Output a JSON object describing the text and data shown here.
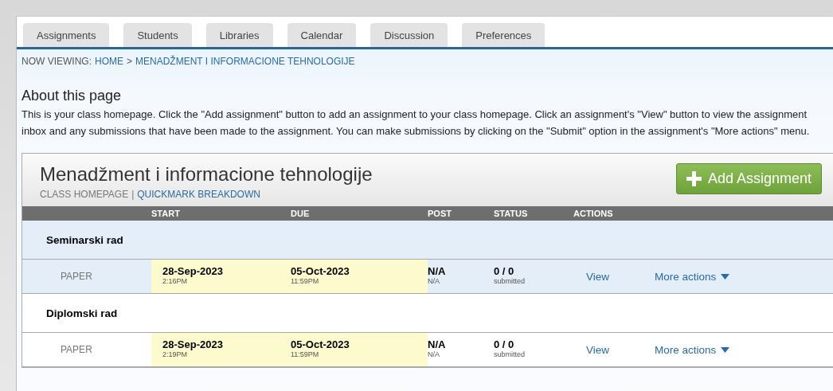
{
  "tabs": [
    {
      "label": "Assignments",
      "selected": false
    },
    {
      "label": "Students",
      "selected": false
    },
    {
      "label": "Libraries",
      "selected": false
    },
    {
      "label": "Calendar",
      "selected": false
    },
    {
      "label": "Discussion",
      "selected": false
    },
    {
      "label": "Preferences",
      "selected": false
    }
  ],
  "breadcrumb": {
    "prefix": "NOW VIEWING:",
    "links": [
      "HOME",
      "MENADŽMENT I INFORMACIONE TEHNOLOGIJE"
    ],
    "separator": ">"
  },
  "about": {
    "title": "About this page",
    "text": "This is your class homepage. Click the \"Add assignment\" button to add an assignment to your class homepage. Click an assignment's \"View\" button to view the assignment inbox and any submissions that have been made to the assignment. You can make submissions by clicking on the \"Submit\" option in the assignment's \"More actions\" menu."
  },
  "class": {
    "title": "Menadžment i informacione tehnologije",
    "subnav": [
      "CLASS HOMEPAGE",
      "QUICKMARK BREAKDOWN"
    ],
    "subnav_separator": "|",
    "add_button": "Add Assignment"
  },
  "table": {
    "columns": [
      "START",
      "DUE",
      "POST",
      "STATUS",
      "ACTIONS"
    ],
    "assignments": [
      {
        "name": "Seminarski rad",
        "selected": true,
        "type": "PAPER",
        "start_date": "28-Sep-2023",
        "start_time": "2:16PM",
        "due_date": "05-Oct-2023",
        "due_time": "11:59PM",
        "post": "N/A",
        "post_sub": "N/A",
        "status": "0 / 0",
        "status_sub": "submitted",
        "view": "View",
        "more": "More actions"
      },
      {
        "name": "Diplomski rad",
        "selected": false,
        "type": "PAPER",
        "start_date": "28-Sep-2023",
        "start_time": "2:19PM",
        "due_date": "05-Oct-2023",
        "due_time": "11:59PM",
        "post": "N/A",
        "post_sub": "N/A",
        "status": "0 / 0",
        "status_sub": "submitted",
        "view": "View",
        "more": "More actions"
      }
    ]
  }
}
